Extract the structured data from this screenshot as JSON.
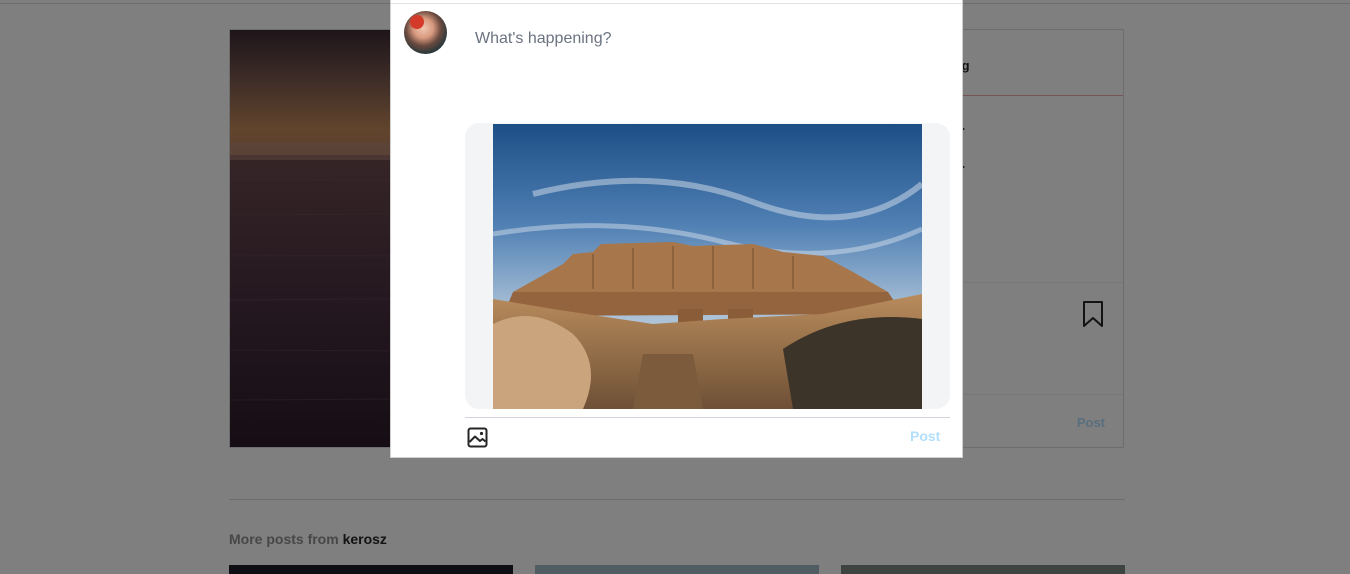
{
  "background": {
    "post_header": {
      "follow_text": "wing"
    },
    "comment_fragments": [
      ">",
      ">"
    ],
    "post_link": "Post",
    "more_posts": {
      "prefix": "More posts from",
      "username": "kerosz"
    }
  },
  "compose_modal": {
    "input": {
      "placeholder": "What's happening?",
      "value": ""
    },
    "avatar_icon": "user-avatar",
    "media_icon": "image-icon",
    "post_button": "Post"
  },
  "colors": {
    "accent_disabled": "#b2dffc",
    "overlay": "rgba(0,0,0,0.5)",
    "preview_bg": "#f3f4f6"
  }
}
